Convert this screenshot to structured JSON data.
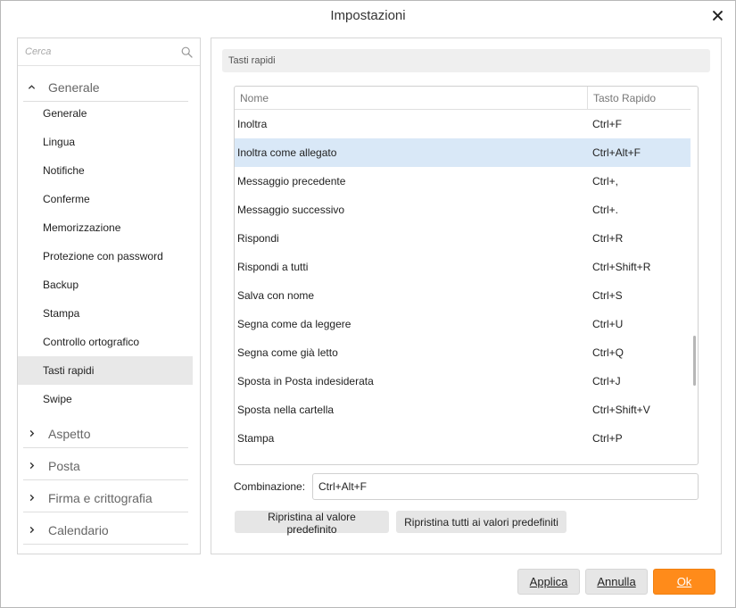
{
  "window": {
    "title": "Impostazioni"
  },
  "icons": {
    "close": "close-icon",
    "search": "search-icon",
    "expanded": "chevron-up-icon",
    "collapsed": "chevron-right-icon"
  },
  "sidebar": {
    "search_placeholder": "Cerca",
    "groups": [
      {
        "label": "Generale",
        "expanded": true
      },
      {
        "label": "Aspetto",
        "expanded": false
      },
      {
        "label": "Posta",
        "expanded": false
      },
      {
        "label": "Firma e crittografia",
        "expanded": false
      },
      {
        "label": "Calendario",
        "expanded": false
      }
    ],
    "items": [
      {
        "label": "Generale"
      },
      {
        "label": "Lingua"
      },
      {
        "label": "Notifiche"
      },
      {
        "label": "Conferme"
      },
      {
        "label": "Memorizzazione"
      },
      {
        "label": "Protezione con password"
      },
      {
        "label": "Backup"
      },
      {
        "label": "Stampa"
      },
      {
        "label": "Controllo ortografico"
      },
      {
        "label": "Tasti rapidi",
        "active": true
      },
      {
        "label": "Swipe"
      }
    ]
  },
  "main": {
    "section_title": "Tasti rapidi",
    "table": {
      "headers": {
        "name": "Nome",
        "shortcut": "Tasto Rapido"
      },
      "rows": [
        {
          "name": "Inoltra",
          "shortcut": "Ctrl+F"
        },
        {
          "name": "Inoltra come allegato",
          "shortcut": "Ctrl+Alt+F",
          "selected": true
        },
        {
          "name": "Messaggio precedente",
          "shortcut": "Ctrl+,"
        },
        {
          "name": "Messaggio successivo",
          "shortcut": "Ctrl+."
        },
        {
          "name": "Rispondi",
          "shortcut": "Ctrl+R"
        },
        {
          "name": "Rispondi a tutti",
          "shortcut": "Ctrl+Shift+R"
        },
        {
          "name": "Salva con nome",
          "shortcut": "Ctrl+S"
        },
        {
          "name": "Segna come da leggere",
          "shortcut": "Ctrl+U"
        },
        {
          "name": "Segna come già letto",
          "shortcut": "Ctrl+Q"
        },
        {
          "name": "Sposta in Posta indesiderata",
          "shortcut": "Ctrl+J"
        },
        {
          "name": "Sposta nella cartella",
          "shortcut": "Ctrl+Shift+V"
        },
        {
          "name": "Stampa",
          "shortcut": "Ctrl+P"
        }
      ]
    },
    "combination_label": "Combinazione:",
    "combination_value": "Ctrl+Alt+F",
    "reset_button": "Ripristina al valore predefinito",
    "reset_all_button": "Ripristina tutti ai valori predefiniti"
  },
  "footer": {
    "apply_label": "Applica",
    "cancel_label": "Annulla",
    "ok_label": "Ok"
  },
  "colors": {
    "accent": "#ff8b1a",
    "selected_row": "#d9e8f7",
    "active_nav": "#e8e8e8"
  }
}
